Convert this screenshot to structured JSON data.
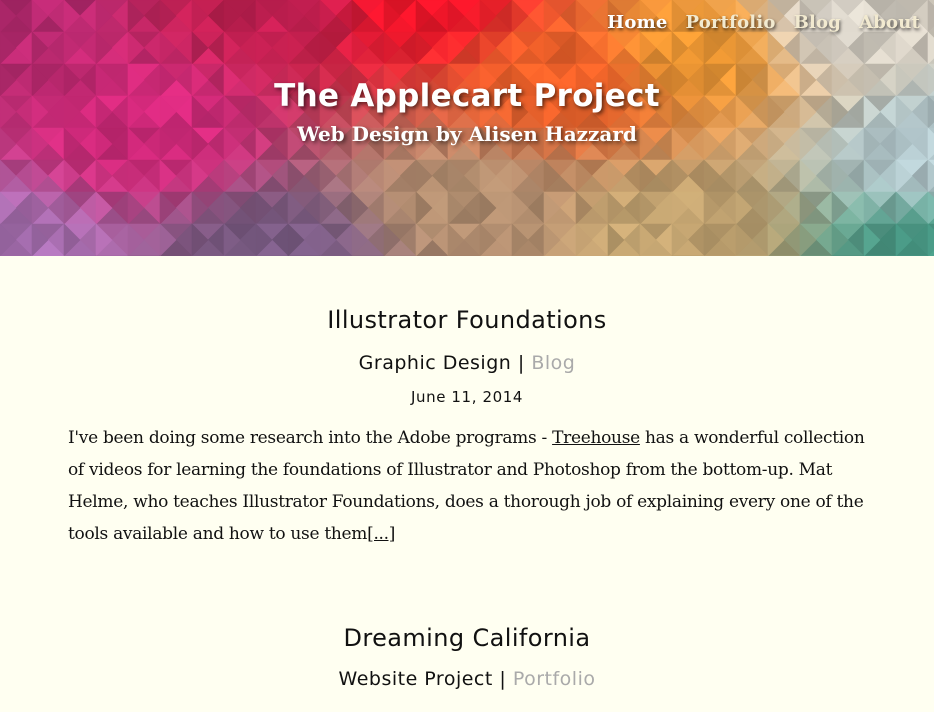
{
  "header": {
    "nav": [
      {
        "label": "Home"
      },
      {
        "label": "Portfolio"
      },
      {
        "label": "Blog"
      },
      {
        "label": "About"
      }
    ],
    "title": "The Applecart Project",
    "subtitle": "Web Design by Alisen Hazzard"
  },
  "posts": [
    {
      "title": "Illustrator Foundations",
      "category": "Graphic Design",
      "separator": "|",
      "section": "Blog",
      "date": "June 11, 2014",
      "excerpt_before": "I've been doing some research into the Adobe programs - ",
      "excerpt_link": "Treehouse",
      "excerpt_after": " has a wonderful collection of videos for learning the foundations of Illustrator and Photoshop from the bottom-up. Mat Helme, who teaches Illustrator Foundations, does a thorough job of explaining every one of the tools available and how to use them",
      "more_label": "[...]"
    },
    {
      "title": "Dreaming California",
      "category": "Website Project",
      "separator": "|",
      "section": "Portfolio"
    }
  ]
}
